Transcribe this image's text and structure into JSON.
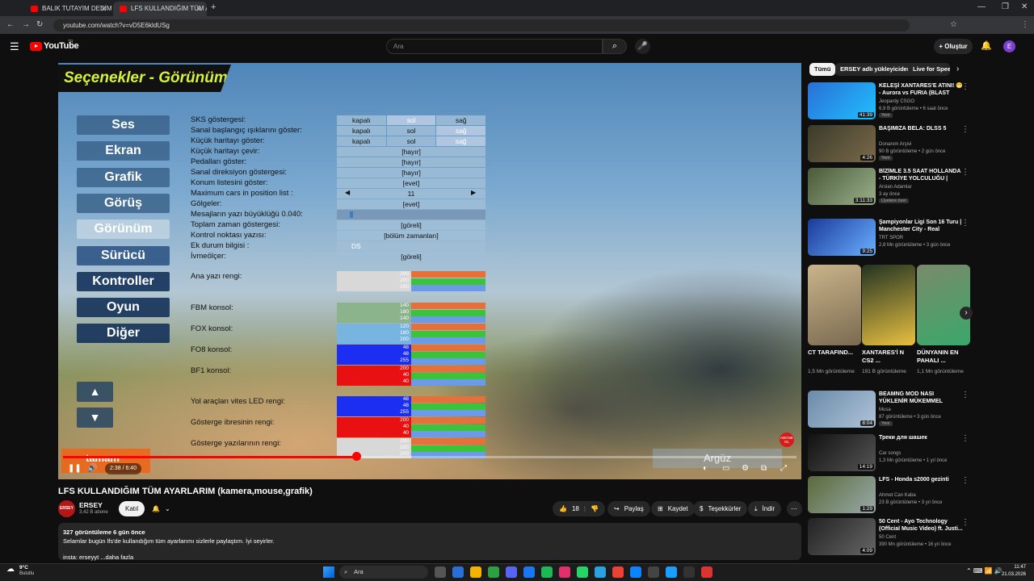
{
  "browser": {
    "tabs": [
      {
        "title": "BALIK TUTAYIM DEDİM BALIĞI"
      },
      {
        "title": "LFS KULLANDIĞIM TÜM AY"
      }
    ],
    "url": "youtube.com/watch?v=vD5E6kldUSg"
  },
  "header": {
    "logo": "YouTube",
    "logo_sup": "TR",
    "search_placeholder": "Ara",
    "create_label": "Oluştur",
    "avatar_letter": "E"
  },
  "game": {
    "title": "Seçenekler - Görünüm",
    "menu": [
      {
        "label": "Ses"
      },
      {
        "label": "Ekran"
      },
      {
        "label": "Grafik"
      },
      {
        "label": "Görüş"
      },
      {
        "label": "Görünüm"
      },
      {
        "label": "Sürücü"
      },
      {
        "label": "Kontroller"
      },
      {
        "label": "Oyun"
      },
      {
        "label": "Diğer"
      }
    ],
    "settings": [
      {
        "label": "SKS göstergesi:",
        "opts": [
          "kapalı",
          "sol",
          "sağ"
        ]
      },
      {
        "label": "Sanal başlangıç ışıklarını göster:",
        "opts": [
          "kapalı",
          "sol",
          "sağ"
        ]
      },
      {
        "label": "Küçük haritayı göster:",
        "opts": [
          "kapalı",
          "sol",
          "sağ"
        ]
      },
      {
        "label": "Küçük haritayı çevir:",
        "value": "[hayır]"
      },
      {
        "label": "Pedalları göster:",
        "value": "[hayır]"
      },
      {
        "label": "Sanal direksiyon göstergesi:",
        "value": "[hayır]"
      },
      {
        "label": "Konum listesini göster:",
        "value": "[evet]"
      },
      {
        "label": "Maximum cars in position list :",
        "value": "11"
      },
      {
        "label": "Gölgeler:",
        "value": "[evet]"
      },
      {
        "label": "Mesajların yazı büyüklüğü 0.040:",
        "value": ""
      },
      {
        "label": "Toplam zaman göstergesi:",
        "value": "[göreli]"
      },
      {
        "label": "Kontrol noktası yazısı:",
        "value": "[bölüm zamanları]"
      },
      {
        "label": "Ek durum bilgisi :",
        "value": "DS"
      },
      {
        "label": "İvmeölçer:",
        "value": "[göreli]"
      }
    ],
    "colors": [
      {
        "label": "Ana yazı rengi:",
        "rgb": [
          "200",
          "200",
          "200"
        ],
        "swatch": "#d8d8d8"
      },
      {
        "label": "FBM konsol:",
        "rgb": [
          "140",
          "180",
          "140"
        ],
        "swatch": "#8cb48c"
      },
      {
        "label": "FOX konsol:",
        "rgb": [
          "120",
          "180",
          "200"
        ],
        "swatch": "#78b4e0"
      },
      {
        "label": "FO8 konsol:",
        "rgb": [
          "48",
          "48",
          "255"
        ],
        "swatch": "#1c2ef2"
      },
      {
        "label": "BF1 konsol:",
        "rgb": [
          "200",
          "40",
          "40"
        ],
        "swatch": "#e81010"
      },
      {
        "label": "Yol araçları vites LED rengi:",
        "rgb": [
          "48",
          "48",
          "255"
        ],
        "swatch": "#1c2ef2"
      },
      {
        "label": "Gösterge ibresinin rengi:",
        "rgb": [
          "200",
          "40",
          "40"
        ],
        "swatch": "#e81010"
      },
      {
        "label": "Gösterge yazılarının rengi:",
        "rgb": [
          "200",
          "200",
          "200"
        ],
        "swatch": "#d8d8d8"
      }
    ],
    "up": "▲",
    "down": "▼",
    "ok_label": "tamam",
    "back_label": "Argüz",
    "subscribe_badge": "ABONE OL"
  },
  "player": {
    "time": "2:38 / 6:40",
    "progress": 0.4
  },
  "video": {
    "title": "LFS KULLANDIĞIM TÜM AYARLARIM (kamera,mouse,grafik)",
    "channel": "ERSEY",
    "subs": "3,42 B abone",
    "join": "Katıl",
    "likes": "18",
    "share": "Paylaş",
    "save": "Kaydet",
    "thanks": "Teşekkürler",
    "download": "İndir",
    "desc_stats": "327 görüntüleme  6 gün önce",
    "desc_text": "Selamlar bugün lfs'de kullandığım tüm ayarlarımı sizlerle paylaştım. İyi seyirler.",
    "desc_more": "insta: erseyyt ...daha fazla",
    "channel_avatar": "ERSEY"
  },
  "sidebar": {
    "chips": [
      "Tümü",
      "ERSEY adlı yükleyiciden",
      "Live for Speed"
    ],
    "recs": [
      {
        "title": "KELEŞİ XANTARES'E ATINI! 😁 - Aurora vs FURIA (BLAST Open...",
        "channel": "Jeopardy CSGO",
        "meta": "6,9 B görüntüleme • 6 saat önce",
        "badge": "Yeni",
        "dur": "41:39",
        "c1": "#2a6fd6",
        "c2": "#20c0ff"
      },
      {
        "title": "BAŞIMIZA BELA: DLSS 5",
        "channel": "Donanım Arşivi",
        "meta": "90 B görüntüleme • 2 gün önce",
        "badge": "Yeni",
        "dur": "4:26",
        "c1": "#3a3a2a",
        "c2": "#7a6a4a"
      },
      {
        "title": "BİZİMLE 3.5 SAAT HOLLANDA - TÜRKİYE YOLCULUĞU | KATIL",
        "channel": "Arslan Adamlar",
        "meta": "3 ay önce",
        "badge": "Üyelere özel",
        "dur": "3:11:33",
        "c1": "#4a5a3a",
        "c2": "#9ab08a"
      },
      {
        "title": "Şampiyonlar Ligi Son 16 Turu | Manchester City - Real Madrid...",
        "channel": "TRT SPOR",
        "meta": "2,8 Mn görüntüleme • 3 gün önce",
        "badge": "",
        "dur": "9:25",
        "c1": "#1a3a9a",
        "c2": "#6ab0ff"
      },
      {
        "title": "BEAMNG MOD NASI YÜKLENİR MÜKEMMEL ANLATIM",
        "channel": "Musa",
        "meta": "87 görüntüleme • 3 gün önce",
        "badge": "Yeni",
        "dur": "8:04",
        "c1": "#6a8aaa",
        "c2": "#b0c4d8"
      },
      {
        "title": "Треки для шашек",
        "channel": "Car songs",
        "meta": "1,3 Mn görüntüleme • 1 yıl önce",
        "badge": "",
        "dur": "14:19",
        "c1": "#111",
        "c2": "#555"
      },
      {
        "title": "LFS - Honda s2000 gezinti",
        "channel": "Ahmet Can Kaba",
        "meta": "23 B görüntüleme • 3 yıl önce",
        "badge": "",
        "dur": "1:29",
        "c1": "#5a6a3a",
        "c2": "#9aa"
      },
      {
        "title": "50 Cent - Ayo Technology (Official Music Video) ft. Justi...",
        "channel": "50 Cent",
        "meta": "390 Mn görüntüleme • 16 yıl önce",
        "badge": "",
        "dur": "4:09",
        "c1": "#222",
        "c2": "#666"
      }
    ],
    "shorts": [
      {
        "title": "CT TARAFIND...",
        "meta": "1,5 Mn görüntüleme",
        "c1": "#c9b48a",
        "c2": "#7a6a50"
      },
      {
        "title": "XANTARES'İ N CS2 ...",
        "meta": "191 B görüntüleme",
        "c1": "#223322",
        "c2": "#e8c040"
      },
      {
        "title": "DÜNYANIN EN PAHALI ...",
        "meta": "1,1 Mn görüntüleme",
        "c1": "#7a8a6a",
        "c2": "#3aa86a"
      }
    ]
  },
  "taskbar": {
    "weather_temp": "9°C",
    "weather_desc": "Bulutlu",
    "search": "Ara",
    "time": "11:47",
    "date": "21.03.2026"
  }
}
